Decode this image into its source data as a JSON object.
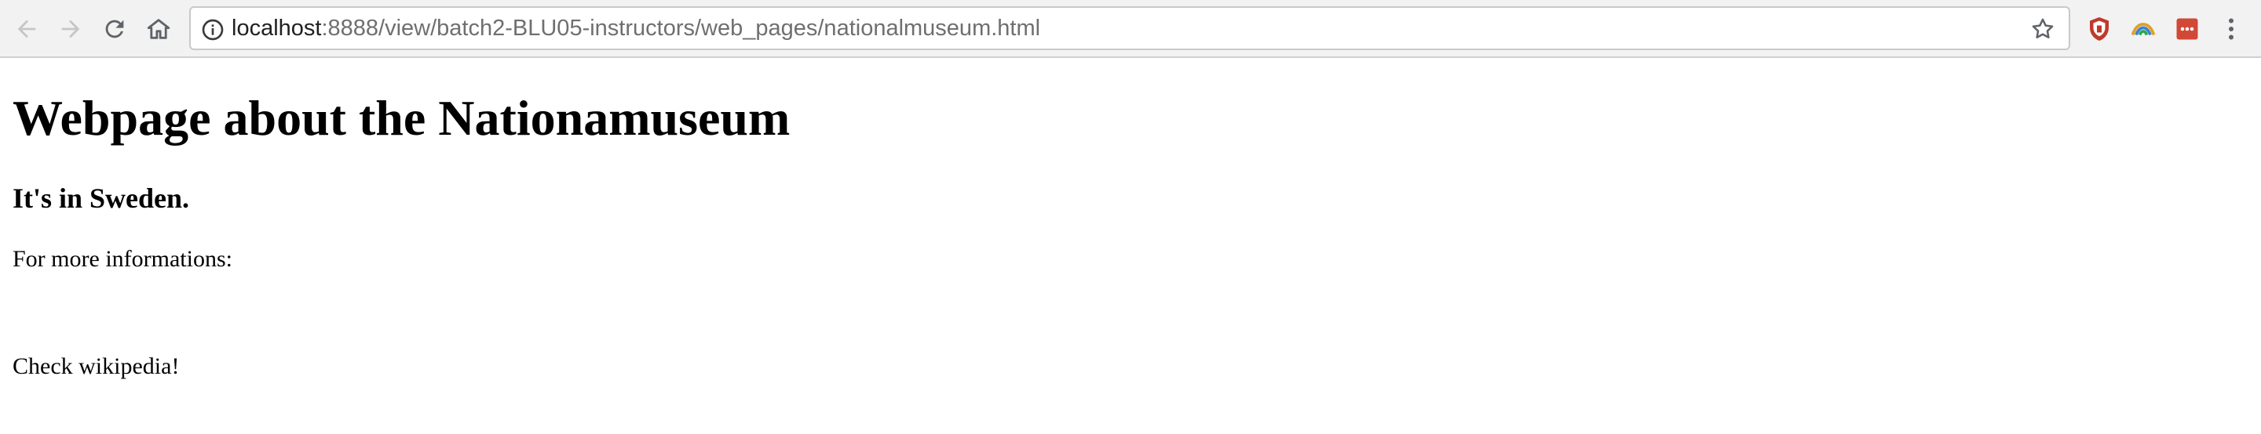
{
  "browser": {
    "url_host": "localhost",
    "url_rest": ":8888/view/batch2-BLU05-instructors/web_pages/nationalmuseum.html",
    "icons": [
      "back-icon",
      "forward-icon",
      "reload-icon",
      "home-icon",
      "info-icon",
      "star-icon",
      "ublock-extension-icon",
      "rainbow-extension-icon",
      "red-extension-icon",
      "kebab-menu-icon"
    ]
  },
  "page": {
    "heading": "Webpage about the Nationamuseum",
    "subheading": "It's in Sweden.",
    "paragraph1": "For more informations:",
    "paragraph2": "Check wikipedia!"
  }
}
